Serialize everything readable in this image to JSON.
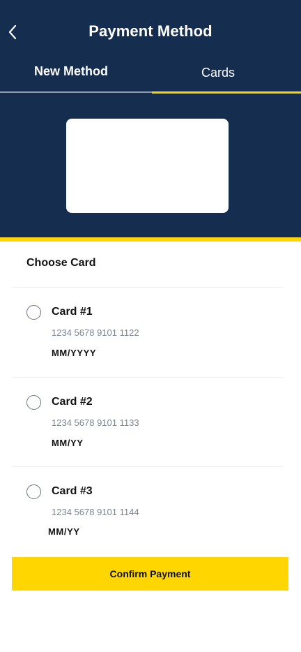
{
  "header": {
    "title": "Payment Method",
    "back_icon": "chevron-left-icon"
  },
  "tabs": [
    {
      "label": "New Method",
      "active": false
    },
    {
      "label": "Cards",
      "active": true
    }
  ],
  "colors": {
    "header_bg": "#152d4f",
    "accent": "#ffd600",
    "text_muted": "#7b8493"
  },
  "choose": {
    "title": "Choose Card"
  },
  "cards": [
    {
      "name": "Card #1",
      "number": "1234 5678 9101 1122",
      "expiry": "MM/YYYY",
      "selected": false
    },
    {
      "name": "Card #2",
      "number": "1234 5678 9101 1133",
      "expiry": "MM/YY",
      "selected": false
    },
    {
      "name": "Card #3",
      "number": "1234 5678 9101 1144",
      "expiry": "MM/YY",
      "selected": false
    }
  ],
  "confirm": {
    "label": "Confirm Payment"
  }
}
